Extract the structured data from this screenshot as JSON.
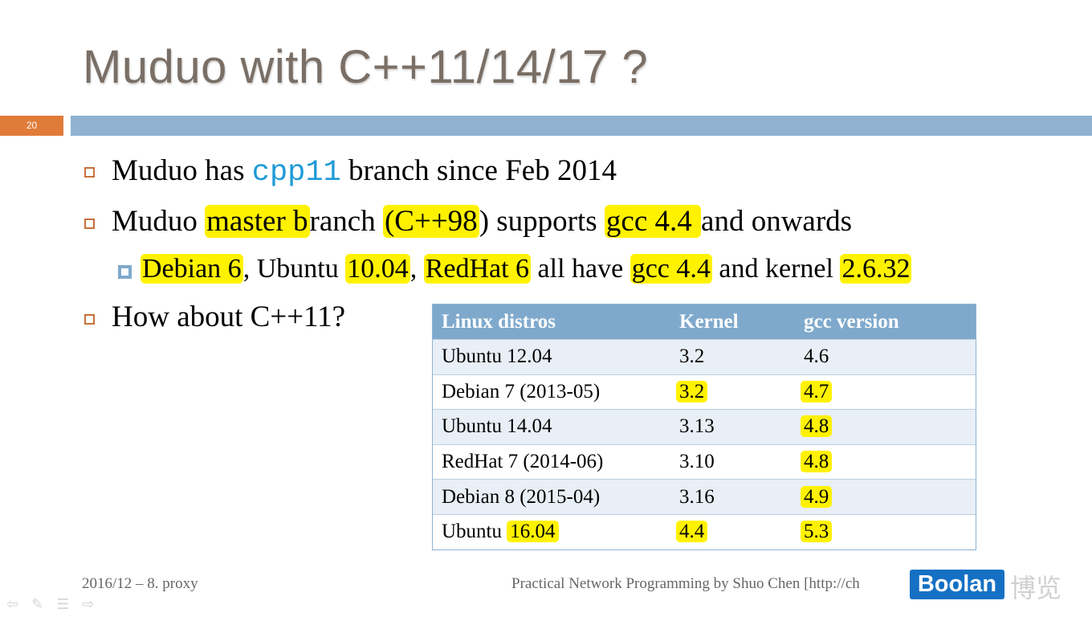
{
  "slide": {
    "title": "Muduo with C++11/14/17 ?",
    "number": "20"
  },
  "bullets": {
    "b1": {
      "pre": "Muduo has ",
      "code": "cpp11",
      "post": " branch since Feb 2014"
    },
    "b2": {
      "p1": "Muduo ",
      "p2": "master b",
      "p3": "ranch ",
      "p4": "(C++98",
      "p5": ") supports ",
      "p6": "gcc 4.4 ",
      "p7": "and onwards"
    },
    "sub": {
      "s1": "Debian 6",
      "s2": ", Ubuntu ",
      "s3": "10.04",
      "s4": ", ",
      "s5": "RedHat 6",
      "s6": " all have ",
      "s7": "gcc 4.4",
      "s8": " and kernel ",
      "s9": "2.6.32"
    },
    "b3": "How about C++11?"
  },
  "table": {
    "headers": [
      "Linux distros",
      "Kernel",
      "gcc version"
    ],
    "rows": [
      {
        "distro": "Ubuntu 12.04",
        "kernel": "3.2",
        "gcc": "4.6"
      },
      {
        "distro": "Debian 7 (2013-05)",
        "kernel": "3.2",
        "gcc": "4.7"
      },
      {
        "distro": "Ubuntu 14.04",
        "kernel": "3.13",
        "gcc": "4.8"
      },
      {
        "distro": "RedHat 7 (2014-06)",
        "kernel": "3.10",
        "gcc": "4.8"
      },
      {
        "distro": "Debian 8 (2015-04)",
        "kernel": "3.16",
        "gcc": "4.9"
      },
      {
        "distro_pre": "Ubuntu ",
        "distro_hl": "16.04",
        "kernel": "4.4",
        "gcc": "5.3"
      }
    ]
  },
  "footer": {
    "left": "2016/12 – 8. proxy",
    "right": "Practical Network Programming by Shuo Chen [http://ch",
    "logo": "Boolan",
    "logo_cn": "博览"
  },
  "colors": {
    "accent_orange": "#e07b39",
    "title_bar": "#8fb3d1",
    "table_header": "#7fa9cc",
    "highlight": "#fff200",
    "code_blue": "#1e9ad6"
  }
}
